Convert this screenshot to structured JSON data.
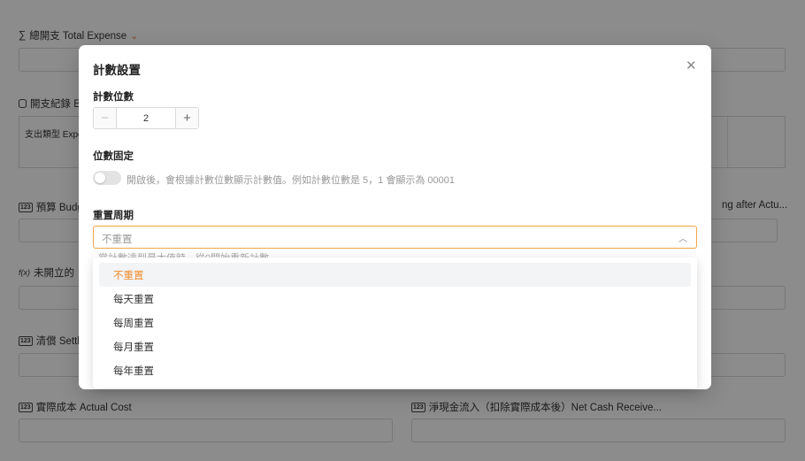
{
  "background": {
    "total_expense_label": "總開支 Total Expense",
    "expense_record_label": "開支紀錄 E",
    "table_col_expense_type": "支出類型 Expe",
    "budget_label": "預算 Budg",
    "right_trunc_label": "ng after Actu...",
    "uncreated_label": "未開立的",
    "settle_label": "清償 Settle",
    "actual_cost_label": "實際成本 Actual Cost",
    "net_cash_label": "淨現金流入（扣除實際成本後）Net Cash Receive...",
    "icons": {
      "sum": "sum-icon",
      "table": "table-icon",
      "number": "number-icon",
      "formula": "formula-icon"
    },
    "icon_text": {
      "number": "123",
      "formula": "f(x)"
    }
  },
  "modal": {
    "title": "計數設置",
    "close_glyph": "✕",
    "digits": {
      "label": "計數位數",
      "value": "2",
      "minus": "−",
      "plus": "+"
    },
    "fixed_digits": {
      "label": "位數固定",
      "toggle_on": false,
      "hint": "開啟後，會根據計數位數顯示計數值。例如計數位數是 5，1 會顯示為 00001"
    },
    "reset_period": {
      "label": "重置周期",
      "selected": "不重置",
      "hint": "當計數達到最大值時，從0開始重新計數",
      "options": [
        "不重置",
        "每天重置",
        "每周重置",
        "每月重置",
        "每年重置"
      ]
    }
  },
  "colors": {
    "accent": "#f08a2a",
    "select_border": "#f0a44b"
  }
}
